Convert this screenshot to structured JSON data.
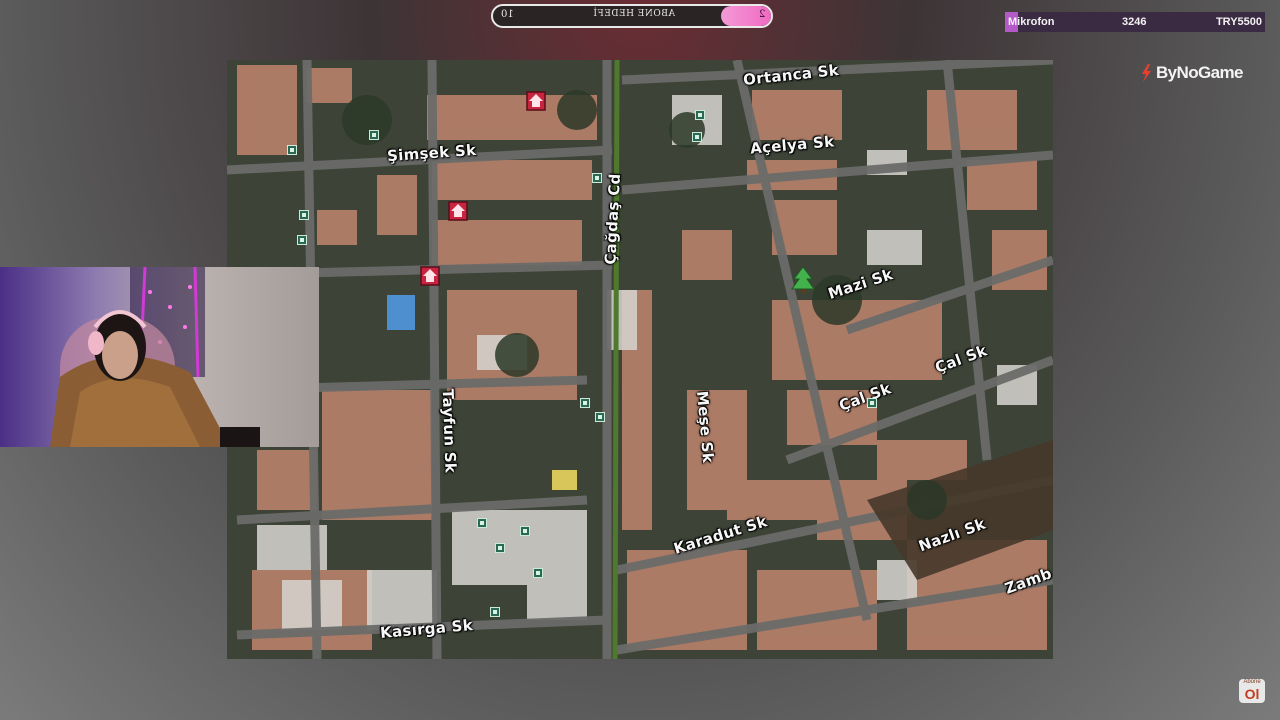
{
  "goal": {
    "label": "ABONE HEDEFİ",
    "left_value": "10",
    "right_value": "2",
    "progress": 0.18,
    "fill_color": "#f06ac2"
  },
  "mic": {
    "label": "Mikrofon",
    "count": "3246",
    "target": "TRY5500",
    "progress": 0.05,
    "bar_color": "#3a2b43",
    "fill_color": "#b35ac8"
  },
  "brand": {
    "name": "ByNoGame",
    "icon": "bynogame-logo-icon"
  },
  "map": {
    "icons": {
      "marker": "home-marker-icon",
      "poi": "poi-square-icon",
      "park": "tree-icon"
    },
    "streets": {
      "ortanca": "Ortanca Sk",
      "simsek": "Şimşek Sk",
      "acelya": "Açelya Sk",
      "cagdas": "Çağdaş Cd",
      "mazi": "Mazi Sk",
      "cal1": "Çal Sk",
      "cal2": "Çal Sk",
      "tayfun": "Tayfun Sk",
      "mese": "Meşe Sk",
      "karadut": "Karadut Sk",
      "nazli": "Nazlı Sk",
      "zamb": "Zamb",
      "kasirga": "Kasırga Sk"
    }
  },
  "corner_badge": {
    "top": "Abone",
    "bottom": "Ol"
  }
}
